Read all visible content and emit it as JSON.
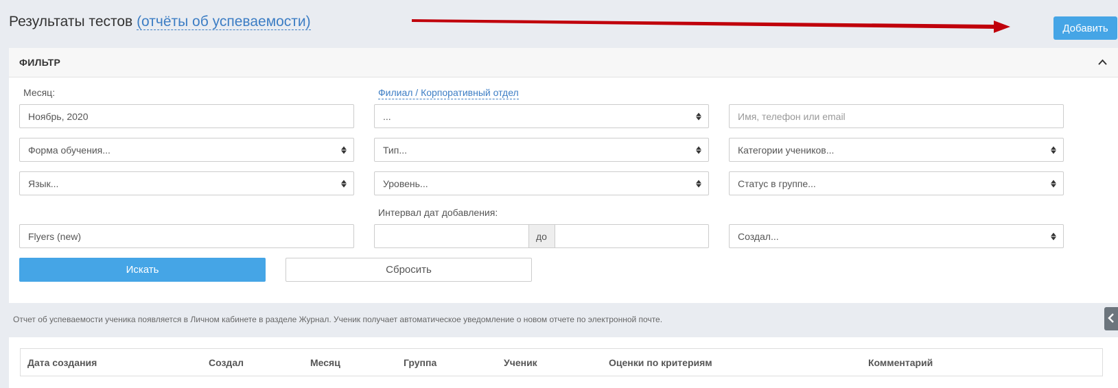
{
  "header": {
    "title": "Результаты тестов",
    "link": "(отчёты об успеваемости)",
    "add_label": "Добавить"
  },
  "filter": {
    "title": "ФИЛЬТР",
    "month_label": "Месяц:",
    "month_value": "Ноябрь, 2020",
    "branch_label": "Филиал / Корпоративный отдел",
    "branch_value": "...",
    "contact_placeholder": "Имя, телефон или email",
    "form_value": "Форма обучения...",
    "type_value": "Тип...",
    "categories_value": "Категории учеников...",
    "language_value": "Язык...",
    "level_value": "Уровень...",
    "status_value": "Статус в группе...",
    "date_interval_label": "Интервал дат добавления:",
    "test_value": "Flyers (new)",
    "date_from": "",
    "date_sep": "до",
    "date_to": "",
    "creator_value": "Создал...",
    "search_label": "Искать",
    "reset_label": "Сбросить"
  },
  "note": "Отчет об успеваемости ученика появляется в Личном кабинете в разделе Журнал. Ученик получает автоматическое уведомление о новом отчете по электронной почте.",
  "table": {
    "columns": [
      "Дата создания",
      "Создал",
      "Месяц",
      "Группа",
      "Ученик",
      "Оценки по критериям",
      "Комментарий"
    ]
  },
  "colors": {
    "accent": "#45a5e6",
    "link": "#3c7dc4",
    "arrow": "#c0000b",
    "background": "#e9ecf1"
  },
  "icons": {
    "collapse": "chevron-up-icon",
    "side_toggle": "chevron-left-icon",
    "select": "sort-arrows-icon"
  }
}
